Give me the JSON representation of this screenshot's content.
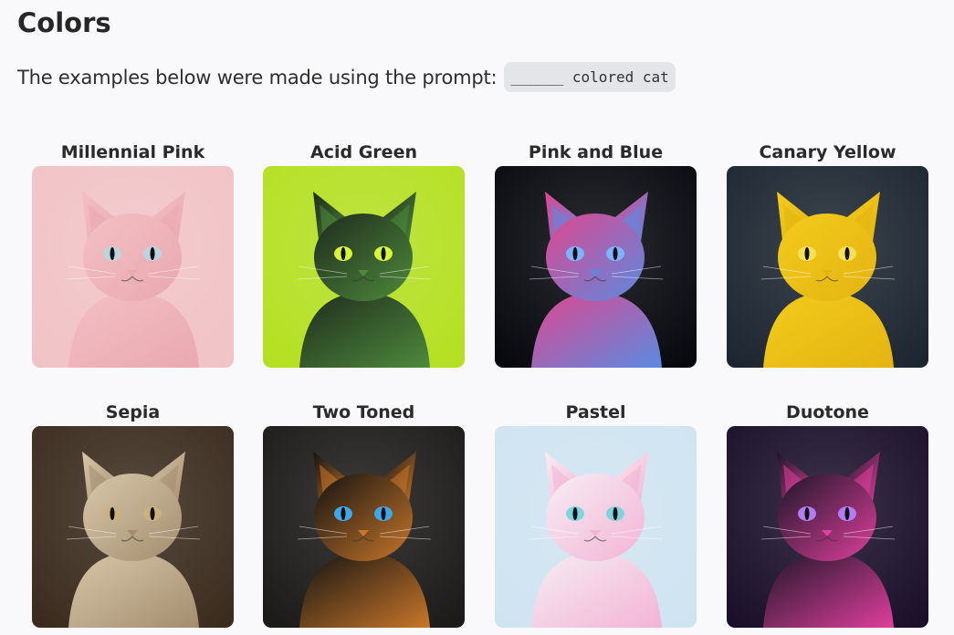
{
  "page": {
    "title": "Colors",
    "intro_text": "The examples below were made using the prompt:",
    "prompt_code": "______ colored cat"
  },
  "cards": [
    {
      "label": "Millennial Pink",
      "bg": "#f1c3c6",
      "fur": "#f3c0c4",
      "fur2": "#e9a8b0",
      "eye": "#bcd3e0"
    },
    {
      "label": "Acid Green",
      "bg": "#b4e021",
      "fur": "#1f2a1d",
      "fur2": "#4e8a3c",
      "eye": "#d9f53a"
    },
    {
      "label": "Pink and Blue",
      "bg": "#06080d",
      "fur": "#e0468f",
      "fur2": "#5a8ae0",
      "eye": "#7fb3ff"
    },
    {
      "label": "Canary Yellow",
      "bg": "#1c2530",
      "fur": "#f3cb1d",
      "fur2": "#e4b411",
      "eye": "#f7e15a"
    },
    {
      "label": "Sepia",
      "bg": "#3a2b1d",
      "fur": "#d9c7aa",
      "fur2": "#a38d6e",
      "eye": "#c8b27d"
    },
    {
      "label": "Two Toned",
      "bg": "#1c1a18",
      "fur": "#121212",
      "fur2": "#c9772a",
      "eye": "#3ea8e8"
    },
    {
      "label": "Pastel",
      "bg": "#cfe4f1",
      "fur": "#f6eef3",
      "fur2": "#f3b3d6",
      "eye": "#7fd3de"
    },
    {
      "label": "Duotone",
      "bg": "#1a0f2a",
      "fur": "#1b1628",
      "fur2": "#e03f9c",
      "eye": "#b27cf2"
    }
  ]
}
